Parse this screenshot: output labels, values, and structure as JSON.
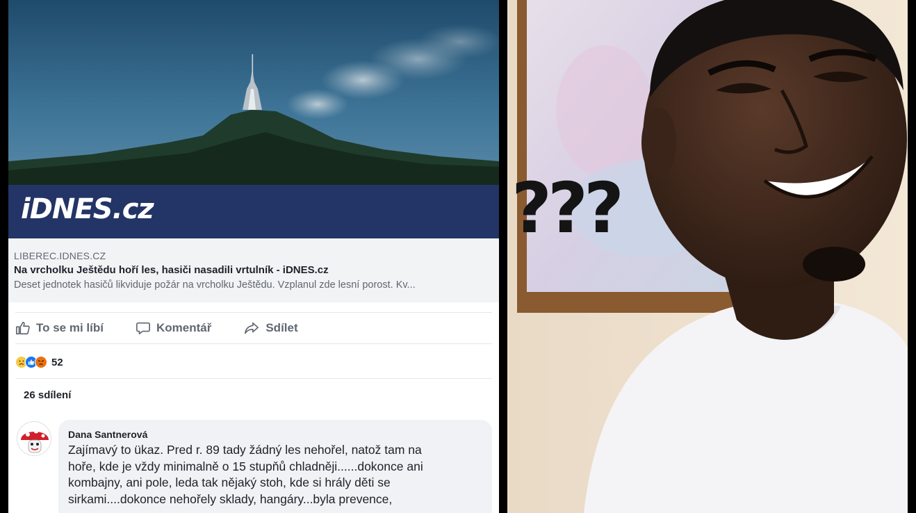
{
  "post": {
    "image_brand": "iDNES.cz",
    "link_domain": "LIBEREC.IDNES.CZ",
    "link_title": "Na vrcholku Ještědu hoří les, hasiči nasadili vrtulník - iDNES.cz",
    "link_description": "Deset jednotek hasičů likviduje požár na vrcholku Ještědu. Vzplanul zde lesní porost. Kv...",
    "actions": {
      "like": "To se mi líbí",
      "comment": "Komentář",
      "share": "Sdílet"
    },
    "reaction_count": "52",
    "shares": "26 sdílení",
    "comment": {
      "author": "Dana Santnerová",
      "text": "Zajímavý to ükaz. Pred r. 89 tady žádný les nehořel, natož tam na\nhoře, kde je vždy minimalně o 15 stupňů chladněji......dokonce ani\nkombajny, ani pole, leda tak nějaký stoh, kde si hrály děti se\nsirkami....dokonce nehořely sklady, hangáry...byla prevence,"
    }
  },
  "meme": {
    "caption": "???"
  },
  "colors": {
    "brand_band": "#233466",
    "facebook_blue": "#1877f2",
    "meta_background": "#f2f3f5"
  },
  "icons": {
    "like": "thumbs-up-icon",
    "comment": "speech-bubble-icon",
    "share": "share-arrow-icon"
  }
}
